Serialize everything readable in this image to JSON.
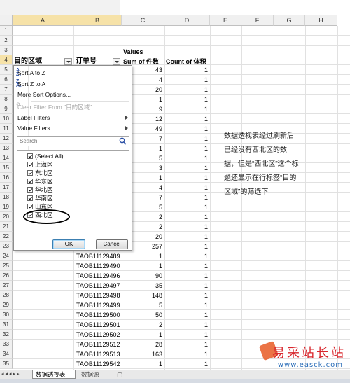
{
  "columns": [
    "A",
    "B",
    "C",
    "D",
    "E",
    "F",
    "G",
    "H"
  ],
  "header_rows": {
    "r3_values": "Values",
    "r4": {
      "a": "目的区域",
      "b": "订单号",
      "c": "Sum of 件数",
      "d": "Count of 体积"
    }
  },
  "rows": [
    {
      "n": "1",
      "b": "",
      "c": "",
      "d": ""
    },
    {
      "n": "2",
      "b": "",
      "c": "",
      "d": ""
    },
    {
      "n": "3",
      "b": "",
      "c": "",
      "d": ""
    },
    {
      "n": "4",
      "b": "",
      "c": "",
      "d": ""
    },
    {
      "n": "5",
      "b": "",
      "c": "43",
      "d": "1"
    },
    {
      "n": "6",
      "b": "",
      "c": "4",
      "d": "1"
    },
    {
      "n": "7",
      "b": "",
      "c": "20",
      "d": "1"
    },
    {
      "n": "8",
      "b": "",
      "c": "1",
      "d": "1"
    },
    {
      "n": "9",
      "b": "",
      "c": "9",
      "d": "1"
    },
    {
      "n": "10",
      "b": "",
      "c": "12",
      "d": "1"
    },
    {
      "n": "11",
      "b": "",
      "c": "49",
      "d": "1"
    },
    {
      "n": "12",
      "b": "",
      "c": "7",
      "d": "1"
    },
    {
      "n": "13",
      "b": "",
      "c": "1",
      "d": "1"
    },
    {
      "n": "14",
      "b": "",
      "c": "5",
      "d": "1"
    },
    {
      "n": "15",
      "b": "",
      "c": "3",
      "d": "1"
    },
    {
      "n": "16",
      "b": "",
      "c": "1",
      "d": "1"
    },
    {
      "n": "17",
      "b": "",
      "c": "4",
      "d": "1"
    },
    {
      "n": "18",
      "b": "",
      "c": "7",
      "d": "1"
    },
    {
      "n": "19",
      "b": "",
      "c": "5",
      "d": "1"
    },
    {
      "n": "20",
      "b": "",
      "c": "2",
      "d": "1"
    },
    {
      "n": "21",
      "b": "",
      "c": "2",
      "d": "1"
    },
    {
      "n": "22",
      "b": "",
      "c": "20",
      "d": "1"
    },
    {
      "n": "23",
      "b": "",
      "c": "257",
      "d": "1"
    },
    {
      "n": "24",
      "b": "TAOB11129489",
      "c": "1",
      "d": "1"
    },
    {
      "n": "25",
      "b": "TAOB11129490",
      "c": "1",
      "d": "1"
    },
    {
      "n": "26",
      "b": "TAOB11129496",
      "c": "90",
      "d": "1"
    },
    {
      "n": "27",
      "b": "TAOB11129497",
      "c": "35",
      "d": "1"
    },
    {
      "n": "28",
      "b": "TAOB11129498",
      "c": "148",
      "d": "1"
    },
    {
      "n": "29",
      "b": "TAOB11129499",
      "c": "5",
      "d": "1"
    },
    {
      "n": "30",
      "b": "TAOB11129500",
      "c": "50",
      "d": "1"
    },
    {
      "n": "31",
      "b": "TAOB11129501",
      "c": "2",
      "d": "1"
    },
    {
      "n": "32",
      "b": "TAOB11129502",
      "c": "1",
      "d": "1"
    },
    {
      "n": "33",
      "b": "TAOB11129512",
      "c": "28",
      "d": "1"
    },
    {
      "n": "34",
      "b": "TAOB11129513",
      "c": "163",
      "d": "1"
    },
    {
      "n": "35",
      "b": "TAOB11129542",
      "c": "1",
      "d": "1"
    }
  ],
  "annotation": "数据透视表经过刷新后已经没有西北区的数据，但是“西北区”这个标题还显示在行标签“目的区域”的筛选下",
  "filter_menu": {
    "sort_az": "Sort A to Z",
    "sort_za": "Sort Z to A",
    "more_sort": "More Sort Options...",
    "clear_filter": "Clear Filter From \"目的区域\"",
    "label_filters": "Label Filters",
    "value_filters": "Value Filters",
    "search_placeholder": "Search",
    "items": [
      "(Select All)",
      "上海区",
      "东北区",
      "华东区",
      "华北区",
      "华南区",
      "山东区",
      "西北区"
    ],
    "ok": "OK",
    "cancel": "Cancel"
  },
  "sheet_tabs": {
    "active": "数据透视表",
    "other": "数据源"
  },
  "watermark": {
    "brand": "易采站长站",
    "url": "www.easck.com"
  }
}
